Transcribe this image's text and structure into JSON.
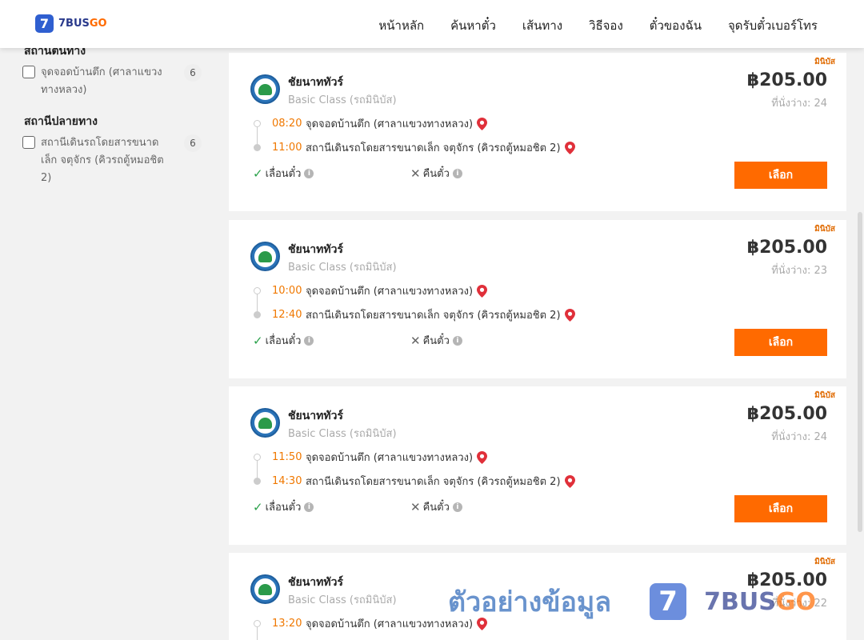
{
  "header": {
    "logo_mark": "7",
    "logo_text_main": "7BUS",
    "logo_text_accent": "GO",
    "nav": [
      {
        "label": "หน้าหลัก"
      },
      {
        "label": "ค้นหาตั๋ว"
      },
      {
        "label": "เส้นทาง"
      },
      {
        "label": "วิธีจอง"
      },
      {
        "label": "ตั๋วของฉัน"
      },
      {
        "label": "จุดรับตั๋วเบอร์โทร"
      }
    ]
  },
  "sidebar": {
    "origin_title": "สถานีต้นทาง",
    "origin_options": [
      {
        "label": "จุดจอดบ้านตึก (ศาลาแขวงทางหลวง)",
        "count": "6"
      }
    ],
    "dest_title": "สถานีปลายทาง",
    "dest_options": [
      {
        "label": "สถานีเดินรถโดยสารขนาดเล็ก จตุจักร (คิวรถตู้หมอชิต 2)",
        "count": "6"
      }
    ]
  },
  "trips": [
    {
      "tag": "มินิบัส",
      "operator": "ชัยนาททัวร์",
      "bus_class": "Basic Class (รถมินิบัส)",
      "price": "฿205.00",
      "seats": "ที่นั่งว่าง: 24",
      "departure_time": "08:20",
      "departure_stop": "จุดจอดบ้านตึก (ศาลาแขวงทางหลวง)",
      "arrival_time": "11:00",
      "arrival_stop": "สถานีเดินรถโดยสารขนาดเล็ก จตุจักร (คิวรถตู้หมอชิต 2)",
      "reschedule": "เลื่อนตั๋ว",
      "refund": "คืนตั๋ว",
      "select_label": "เลือก"
    },
    {
      "tag": "มินิบัส",
      "operator": "ชัยนาททัวร์",
      "bus_class": "Basic Class (รถมินิบัส)",
      "price": "฿205.00",
      "seats": "ที่นั่งว่าง: 23",
      "departure_time": "10:00",
      "departure_stop": "จุดจอดบ้านตึก (ศาลาแขวงทางหลวง)",
      "arrival_time": "12:40",
      "arrival_stop": "สถานีเดินรถโดยสารขนาดเล็ก จตุจักร (คิวรถตู้หมอชิต 2)",
      "reschedule": "เลื่อนตั๋ว",
      "refund": "คืนตั๋ว",
      "select_label": "เลือก"
    },
    {
      "tag": "มินิบัส",
      "operator": "ชัยนาททัวร์",
      "bus_class": "Basic Class (รถมินิบัส)",
      "price": "฿205.00",
      "seats": "ที่นั่งว่าง: 24",
      "departure_time": "11:50",
      "departure_stop": "จุดจอดบ้านตึก (ศาลาแขวงทางหลวง)",
      "arrival_time": "14:30",
      "arrival_stop": "สถานีเดินรถโดยสารขนาดเล็ก จตุจักร (คิวรถตู้หมอชิต 2)",
      "reschedule": "เลื่อนตั๋ว",
      "refund": "คืนตั๋ว",
      "select_label": "เลือก"
    },
    {
      "tag": "มินิบัส",
      "operator": "ชัยนาททัวร์",
      "bus_class": "Basic Class (รถมินิบัส)",
      "price": "฿205.00",
      "seats": "ที่นั่งว่าง: 22",
      "departure_time": "13:20",
      "departure_stop": "จุดจอดบ้านตึก (ศาลาแขวงทางหลวง)",
      "arrival_time": "",
      "arrival_stop": "",
      "reschedule": "",
      "refund": "",
      "select_label": ""
    }
  ],
  "icons": {
    "pin": "map-pin-icon",
    "check": "check-icon",
    "cross": "cross-icon",
    "info": "info-icon"
  },
  "colors": {
    "accent": "#ff6a00",
    "brand_blue": "#2f5fd0",
    "time": "#f07800",
    "pin": "#e0303a",
    "ok": "#2aa14a"
  },
  "watermark": {
    "text": "ตัวอย่างข้อมูล",
    "mark": "7",
    "brand_main": "7BUS",
    "brand_accent": "GO"
  }
}
